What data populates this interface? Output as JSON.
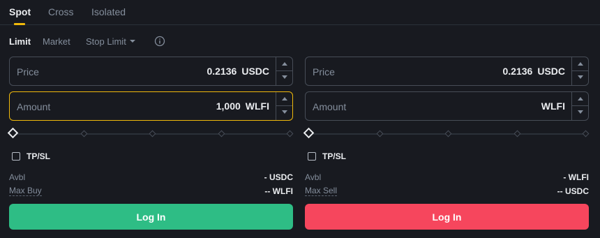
{
  "tabs": [
    {
      "label": "Spot",
      "active": true
    },
    {
      "label": "Cross",
      "active": false
    },
    {
      "label": "Isolated",
      "active": false
    }
  ],
  "order_types": [
    {
      "label": "Limit",
      "active": true
    },
    {
      "label": "Market",
      "active": false
    },
    {
      "label": "Stop Limit",
      "active": false,
      "dropdown": true
    }
  ],
  "info_icon": "info-circle-icon",
  "buy": {
    "price": {
      "label": "Price",
      "value": "0.2136",
      "unit": "USDC"
    },
    "amount": {
      "label": "Amount",
      "value": "1,000",
      "unit": "WLFI"
    },
    "slider_percent": 0,
    "tpsl_label": "TP/SL",
    "tpsl_checked": false,
    "avbl_label": "Avbl",
    "avbl_value": "- USDC",
    "max_label": "Max Buy",
    "max_value": "-- WLFI",
    "button_label": "Log In",
    "button_color": "#2ebd85"
  },
  "sell": {
    "price": {
      "label": "Price",
      "value": "0.2136",
      "unit": "USDC"
    },
    "amount": {
      "label": "Amount",
      "value": "",
      "unit": "WLFI"
    },
    "slider_percent": 0,
    "tpsl_label": "TP/SL",
    "tpsl_checked": false,
    "avbl_label": "Avbl",
    "avbl_value": "- WLFI",
    "max_label": "Max Sell",
    "max_value": "-- USDC",
    "button_label": "Log In",
    "button_color": "#f6465d"
  },
  "colors": {
    "background": "#181a20",
    "accent": "#f0b90b",
    "buy": "#2ebd85",
    "sell": "#f6465d"
  }
}
